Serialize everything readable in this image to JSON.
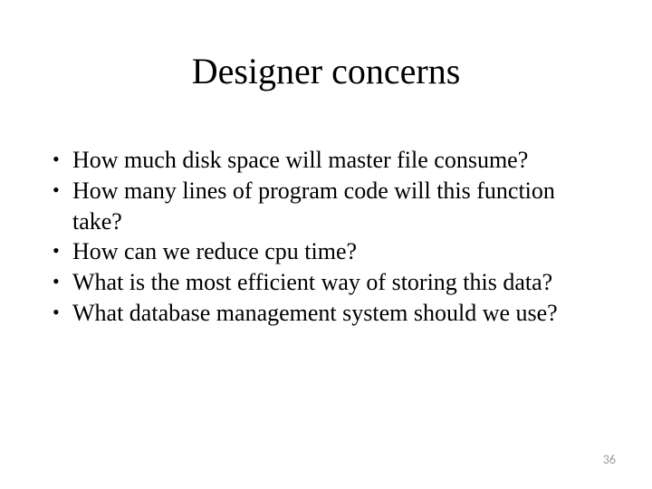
{
  "slide": {
    "title": "Designer concerns",
    "bullets": [
      "How much disk space will master file consume?",
      "How many lines of program code will this function take?",
      "How can we reduce cpu time?",
      "What is the most efficient way of storing this data?",
      "What database management system should we use?"
    ],
    "page_number": "36"
  }
}
